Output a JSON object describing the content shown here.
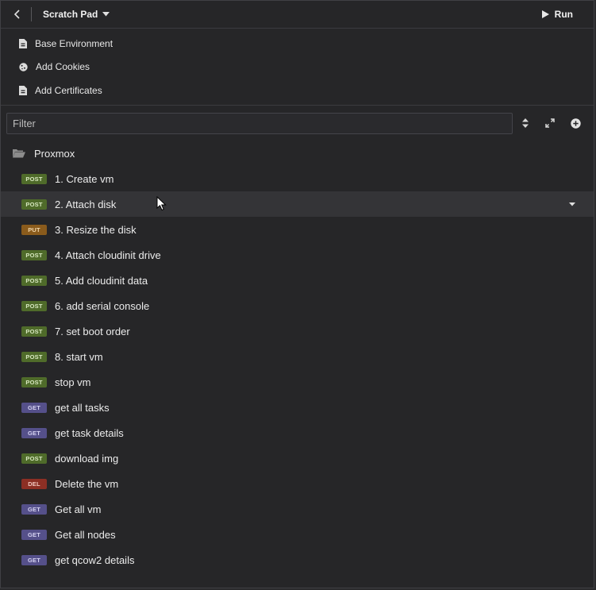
{
  "header": {
    "workspace_title": "Scratch Pad",
    "run_label": "Run"
  },
  "environment": {
    "items": [
      {
        "label": "Base Environment",
        "icon": "environment-file-icon"
      },
      {
        "label": "Add Cookies",
        "icon": "cookie-icon"
      },
      {
        "label": "Add Certificates",
        "icon": "certificate-file-icon"
      }
    ]
  },
  "filter": {
    "placeholder": "Filter",
    "value": ""
  },
  "tree": {
    "folder": {
      "label": "Proxmox",
      "icon": "folder-open-icon"
    },
    "requests": [
      {
        "method": "POST",
        "label": "1. Create vm"
      },
      {
        "method": "POST",
        "label": "2. Attach disk"
      },
      {
        "method": "PUT",
        "label": "3. Resize the disk"
      },
      {
        "method": "POST",
        "label": "4. Attach cloudinit drive"
      },
      {
        "method": "POST",
        "label": "5. Add cloudinit data"
      },
      {
        "method": "POST",
        "label": "6. add serial console"
      },
      {
        "method": "POST",
        "label": "7. set boot order"
      },
      {
        "method": "POST",
        "label": "8. start vm"
      },
      {
        "method": "POST",
        "label": "stop vm"
      },
      {
        "method": "GET",
        "label": "get all tasks"
      },
      {
        "method": "GET",
        "label": "get task details"
      },
      {
        "method": "POST",
        "label": "download img"
      },
      {
        "method": "DEL",
        "label": "Delete the vm"
      },
      {
        "method": "GET",
        "label": "Get all vm"
      },
      {
        "method": "GET",
        "label": "Get all nodes"
      },
      {
        "method": "GET",
        "label": "get qcow2 details"
      }
    ],
    "hovered_index": 1
  },
  "colors": {
    "post": "#4f6b2a",
    "put": "#8a5b1c",
    "get": "#55508a",
    "del": "#8c2f24",
    "background": "#262628"
  }
}
